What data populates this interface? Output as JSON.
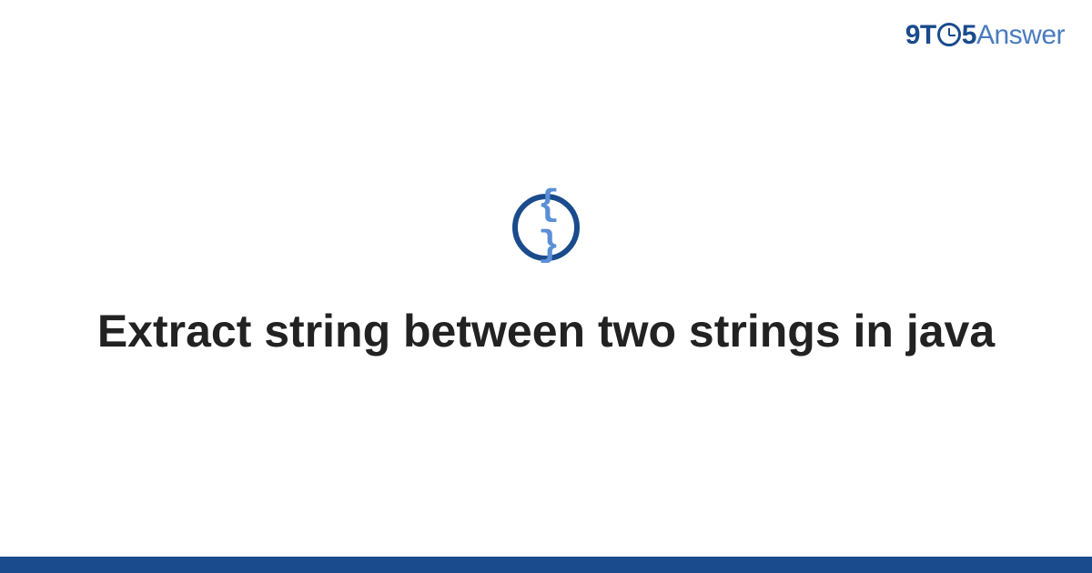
{
  "logo": {
    "part1": "9T",
    "part2": "5",
    "part3": "Answer"
  },
  "icon": {
    "braces": "{ }"
  },
  "title": "Extract string between two strings in java"
}
